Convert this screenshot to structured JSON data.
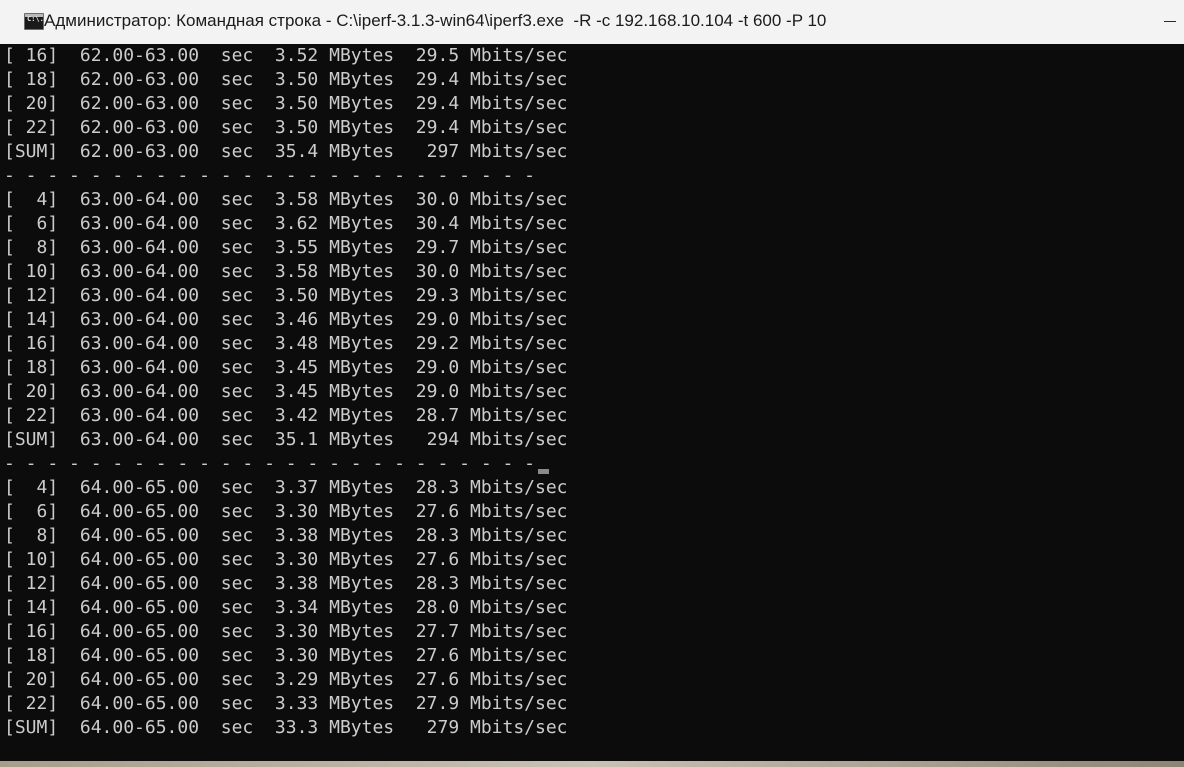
{
  "window": {
    "title": "Администратор: Командная строка - C:\\iperf-3.1.3-win64\\iperf3.exe  -R -c 192.168.10.104 -t 600 -P 10",
    "icon_label": "C:\\."
  },
  "console": {
    "lines": [
      "[ 16]  62.00-63.00  sec  3.52 MBytes  29.5 Mbits/sec",
      "[ 18]  62.00-63.00  sec  3.50 MBytes  29.4 Mbits/sec",
      "[ 20]  62.00-63.00  sec  3.50 MBytes  29.4 Mbits/sec",
      "[ 22]  62.00-63.00  sec  3.50 MBytes  29.4 Mbits/sec",
      "[SUM]  62.00-63.00  sec  35.4 MBytes   297 Mbits/sec",
      "- - - - - - - - - - - - - - - - - - - - - - - - -",
      "[  4]  63.00-64.00  sec  3.58 MBytes  30.0 Mbits/sec",
      "[  6]  63.00-64.00  sec  3.62 MBytes  30.4 Mbits/sec",
      "[  8]  63.00-64.00  sec  3.55 MBytes  29.7 Mbits/sec",
      "[ 10]  63.00-64.00  sec  3.58 MBytes  30.0 Mbits/sec",
      "[ 12]  63.00-64.00  sec  3.50 MBytes  29.3 Mbits/sec",
      "[ 14]  63.00-64.00  sec  3.46 MBytes  29.0 Mbits/sec",
      "[ 16]  63.00-64.00  sec  3.48 MBytes  29.2 Mbits/sec",
      "[ 18]  63.00-64.00  sec  3.45 MBytes  29.0 Mbits/sec",
      "[ 20]  63.00-64.00  sec  3.45 MBytes  29.0 Mbits/sec",
      "[ 22]  63.00-64.00  sec  3.42 MBytes  28.7 Mbits/sec",
      "[SUM]  63.00-64.00  sec  35.1 MBytes   294 Mbits/sec",
      "- - - - - - - - - - - - - - - - - - - - - - - - -",
      "[  4]  64.00-65.00  sec  3.37 MBytes  28.3 Mbits/sec",
      "[  6]  64.00-65.00  sec  3.30 MBytes  27.6 Mbits/sec",
      "[  8]  64.00-65.00  sec  3.38 MBytes  28.3 Mbits/sec",
      "[ 10]  64.00-65.00  sec  3.30 MBytes  27.6 Mbits/sec",
      "[ 12]  64.00-65.00  sec  3.38 MBytes  28.3 Mbits/sec",
      "[ 14]  64.00-65.00  sec  3.34 MBytes  28.0 Mbits/sec",
      "[ 16]  64.00-65.00  sec  3.30 MBytes  27.7 Mbits/sec",
      "[ 18]  64.00-65.00  sec  3.30 MBytes  27.6 Mbits/sec",
      "[ 20]  64.00-65.00  sec  3.29 MBytes  27.6 Mbits/sec",
      "[ 22]  64.00-65.00  sec  3.33 MBytes  27.9 Mbits/sec",
      "[SUM]  64.00-65.00  sec  33.3 MBytes   279 Mbits/sec"
    ]
  },
  "colors": {
    "console_bg": "#0c0c0c",
    "console_fg": "#cccccc",
    "titlebar_bg": "#f3f3f3"
  },
  "icons": {
    "app": "cmd-icon",
    "minimize": "minimize-icon"
  }
}
